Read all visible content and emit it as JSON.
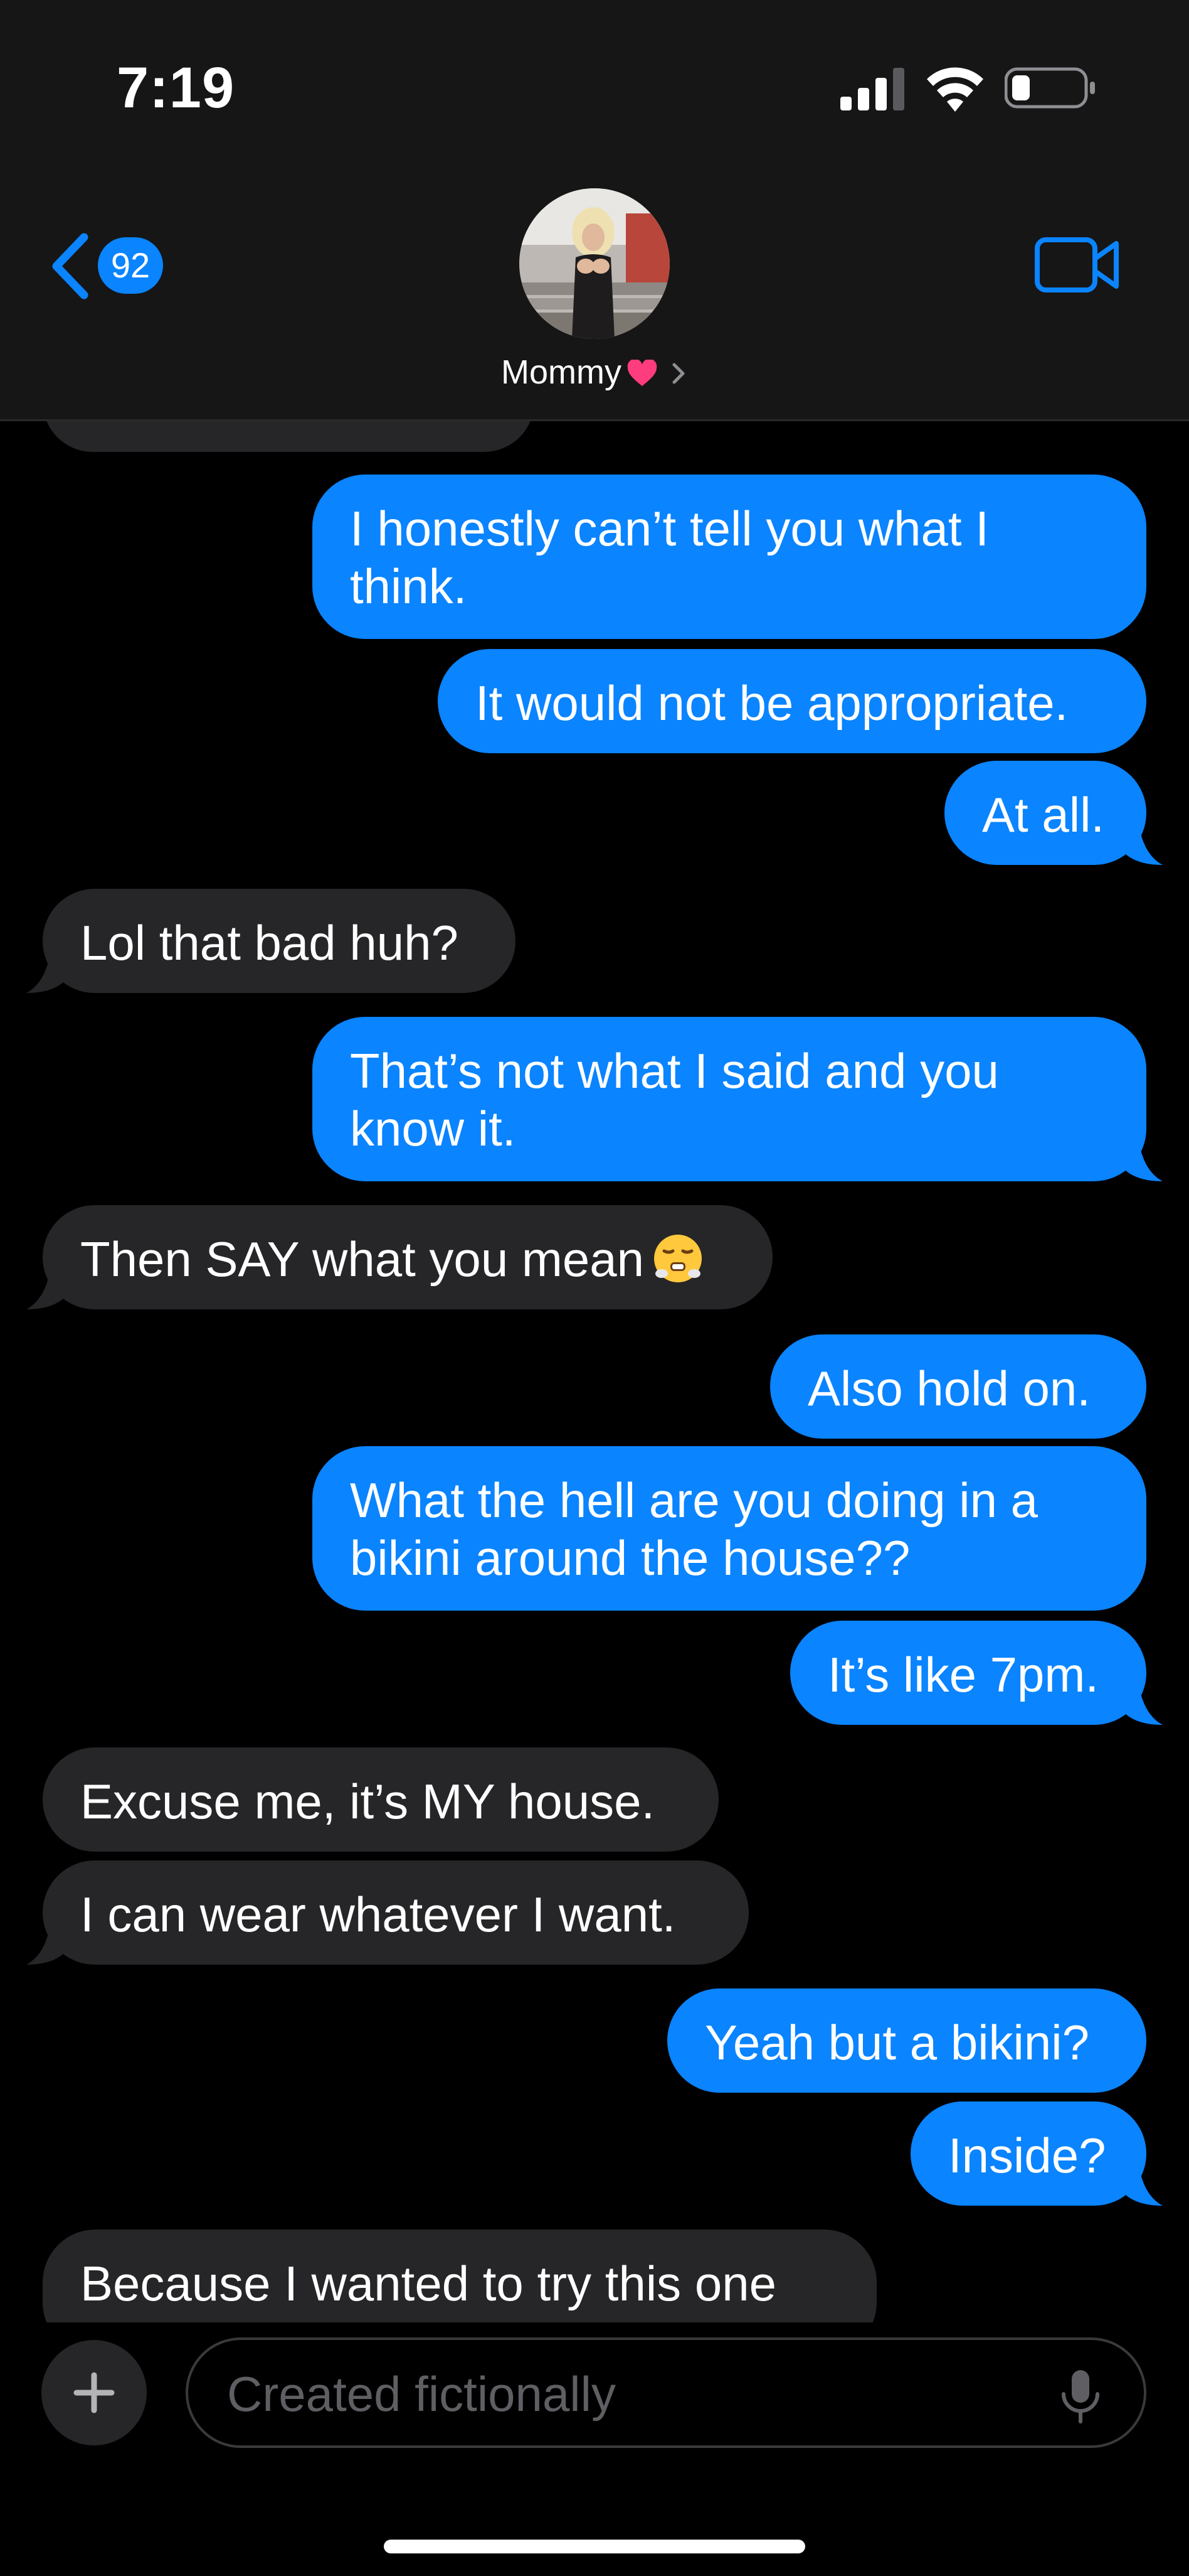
{
  "status_bar": {
    "time": "7:19"
  },
  "header": {
    "back_badge": "92",
    "contact_name": "Mommy"
  },
  "messages": [
    {
      "from": "me",
      "lines": [
        "I honestly can’t tell you what I",
        "think."
      ]
    },
    {
      "from": "me",
      "lines": [
        "It would not be appropriate."
      ]
    },
    {
      "from": "me",
      "lines": [
        "At all."
      ]
    },
    {
      "from": "them",
      "lines": [
        "Lol that bad huh?"
      ]
    },
    {
      "from": "me",
      "lines": [
        "That’s not what I said and you",
        "know it."
      ]
    },
    {
      "from": "them",
      "lines": [
        "Then SAY what you mean"
      ],
      "emoji": "huffing-face-emoji"
    },
    {
      "from": "me",
      "lines": [
        "Also hold on."
      ]
    },
    {
      "from": "me",
      "lines": [
        "What the hell are you doing in a",
        "bikini around the house??"
      ]
    },
    {
      "from": "me",
      "lines": [
        "It’s like 7pm."
      ]
    },
    {
      "from": "them",
      "lines": [
        "Excuse me, it’s MY house."
      ]
    },
    {
      "from": "them",
      "lines": [
        "I can wear whatever I want."
      ]
    },
    {
      "from": "me",
      "lines": [
        "Yeah but a bikini?"
      ]
    },
    {
      "from": "me",
      "lines": [
        "Inside?"
      ]
    },
    {
      "from": "them",
      "lines": [
        "Because I wanted to try this one"
      ]
    }
  ],
  "composer": {
    "placeholder": "Created fictionally"
  },
  "colors": {
    "sent_bubble": "#0a84ff",
    "received_bubble": "#262628",
    "header_bg": "#161616",
    "accent": "#0a84ff"
  },
  "icons": [
    "back-chevron-icon",
    "video-call-icon",
    "heart-icon",
    "chevron-right-icon",
    "plus-icon",
    "microphone-icon",
    "signal-icon",
    "wifi-icon",
    "battery-icon"
  ]
}
